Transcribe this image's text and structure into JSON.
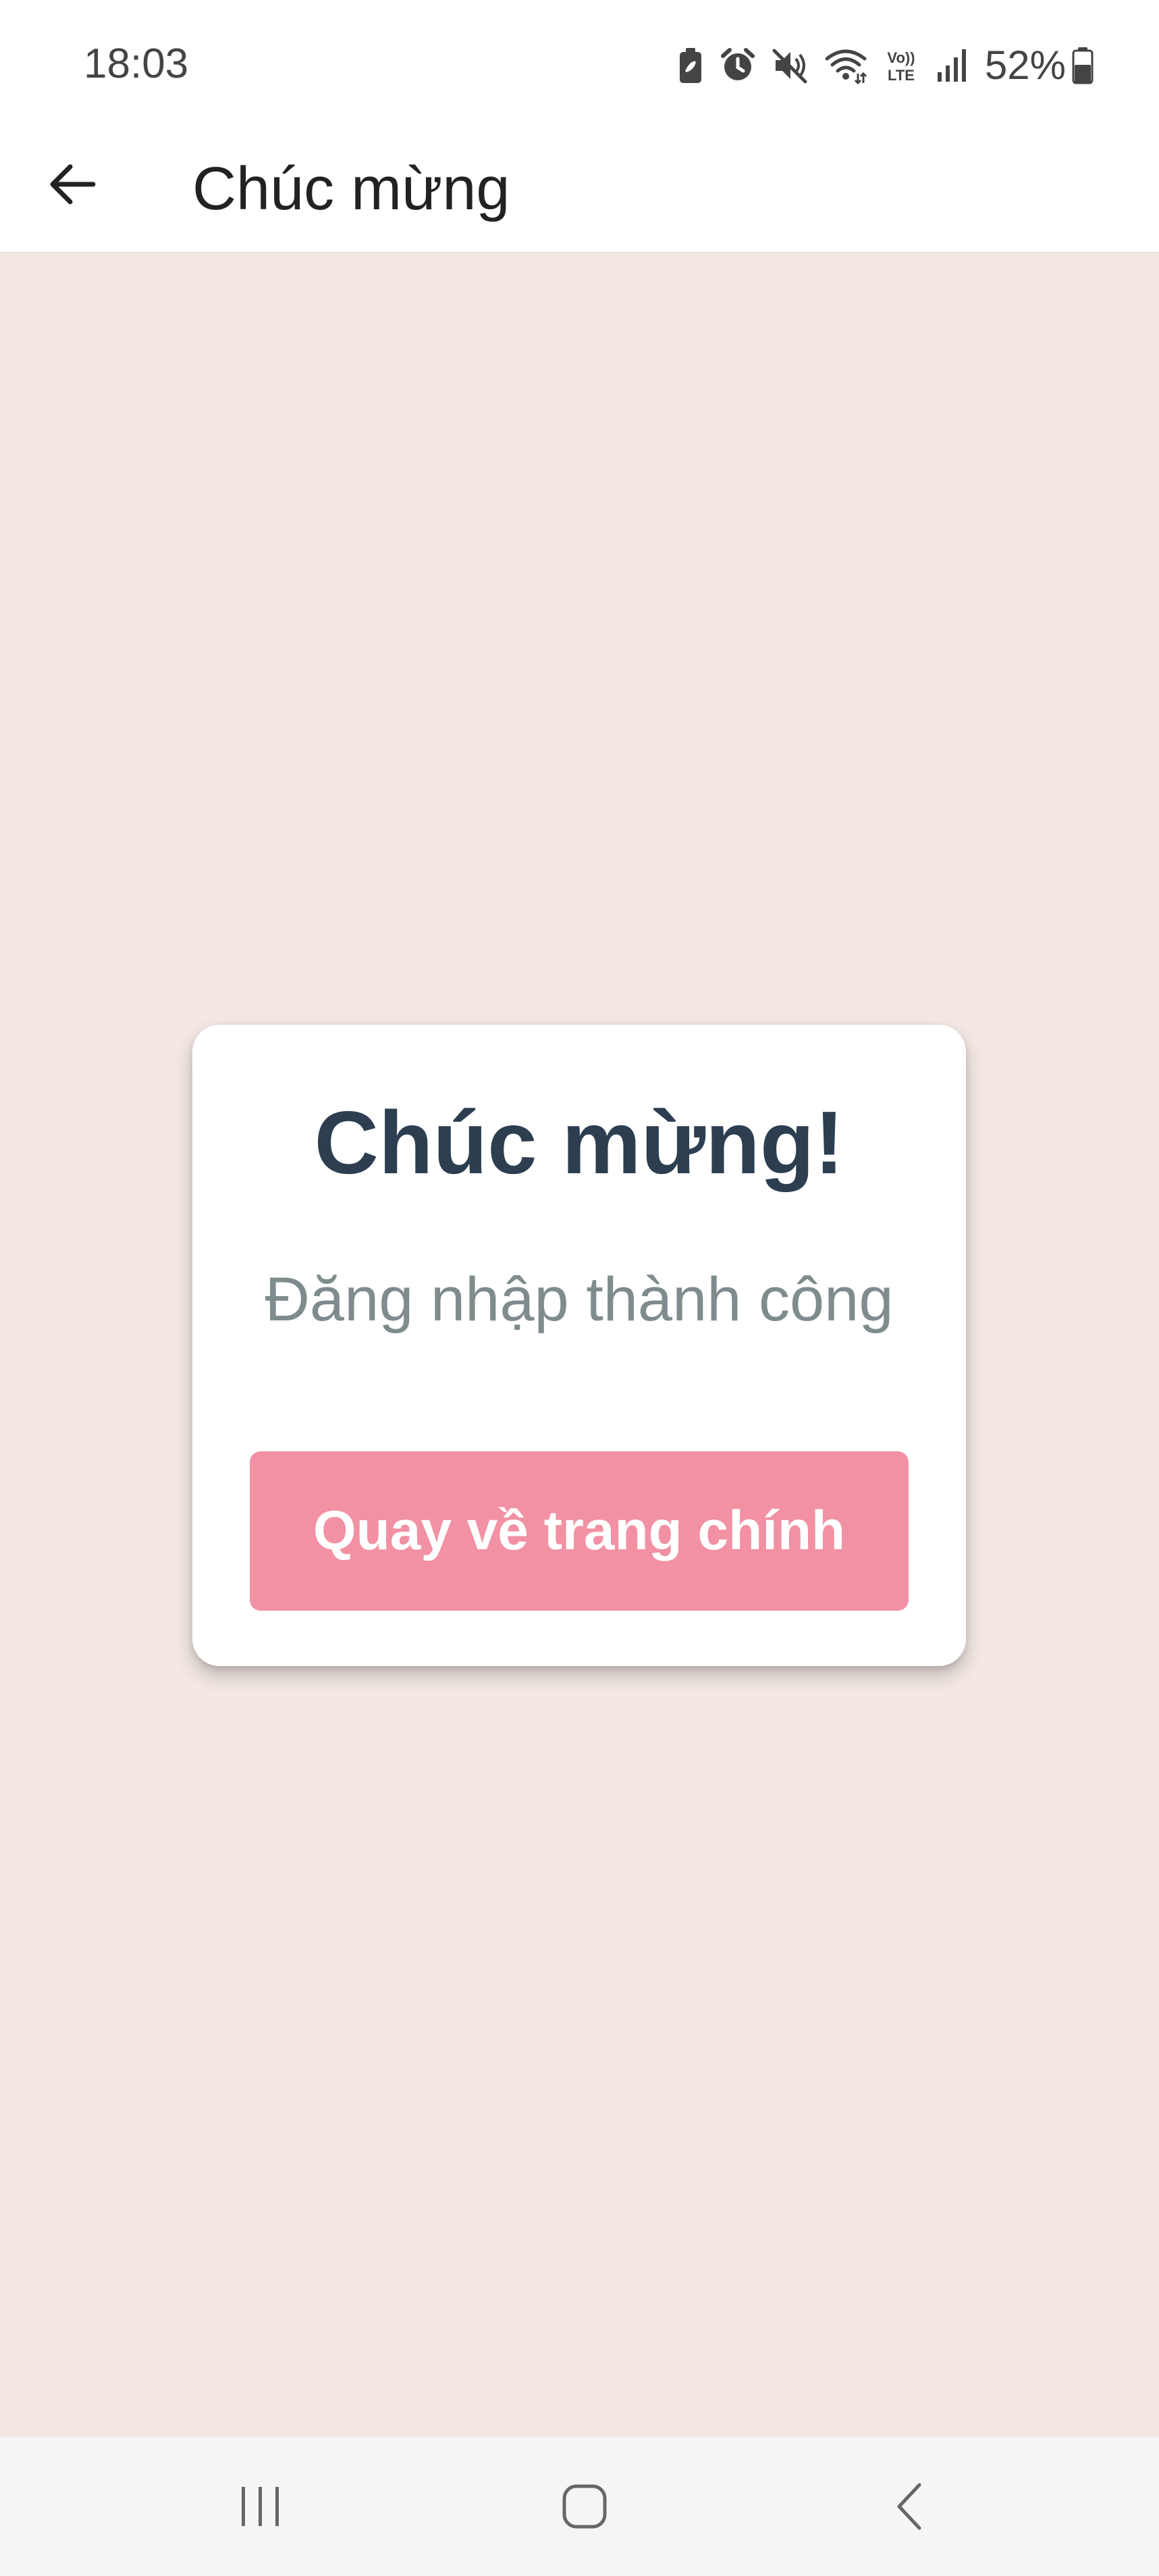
{
  "status_bar": {
    "time": "18:03",
    "battery_percent": "52%",
    "icons": [
      "battery-saver-icon",
      "alarm-icon",
      "mute-icon",
      "wifi-icon",
      "volte-icon",
      "signal-icon",
      "battery-icon"
    ],
    "volte_label_top": "Vo))",
    "volte_label_bottom": "LTE"
  },
  "app_bar": {
    "title": "Chúc mừng",
    "back_icon": "arrow-left-icon"
  },
  "card": {
    "title": "Chúc mừng!",
    "message": "Đăng nhập thành công",
    "button_label": "Quay về trang chính"
  },
  "nav_bar": {
    "icons": [
      "recent-apps-icon",
      "home-icon",
      "back-icon"
    ]
  },
  "colors": {
    "background": "#f3e8e4",
    "card_title": "#2c3e50",
    "card_message": "#7f8c8d",
    "button": "#f291a3",
    "button_text": "#ffffff"
  }
}
